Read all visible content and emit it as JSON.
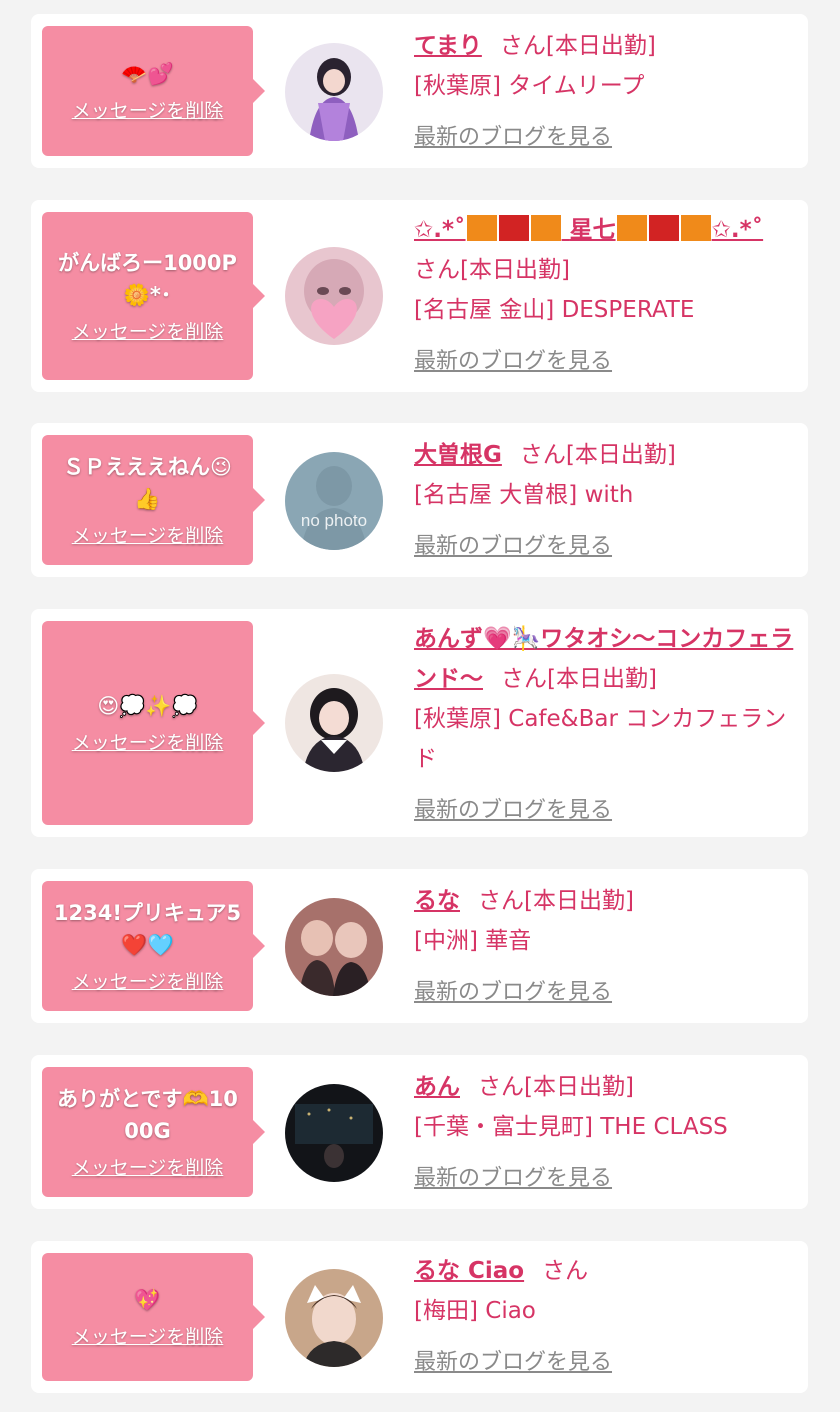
{
  "delete_label": "メッセージを削除",
  "blog_label": "最新のブログを見る",
  "san_label": "さん",
  "today_label": "[本日出勤]",
  "colors": {
    "bubble": "#f58da3",
    "accent": "#d63465",
    "link_gray": "#8a8a8a",
    "background": "#f3f3f3"
  },
  "entries": [
    {
      "message": "🪭💕",
      "name": "てまり",
      "today": "[本日出勤]",
      "shop": "[秋葉原] タイムリープ",
      "avatar_icon": "avatar-photo"
    },
    {
      "message": "がんばろー1000P🌼*･",
      "name_prefix": "✩.*˚",
      "name_core": "星七",
      "name_suffix": "✩.*˚",
      "name_blocks": [
        "🟧",
        "🟥",
        "🟧"
      ],
      "today": "[本日出勤]",
      "shop": "[名古屋 金山] DESPERATE",
      "avatar_icon": "avatar-photo"
    },
    {
      "message": "ＳＰえええねん😉👍",
      "name": "大曽根G",
      "today": "[本日出勤]",
      "shop": "[名古屋 大曽根] with",
      "avatar_icon": "no-photo-avatar",
      "avatar_text": "no photo"
    },
    {
      "message": "😍💭✨💭",
      "name": "あんず💗🎠ワタオシ〜コンカフェランド〜",
      "today": "[本日出勤]",
      "shop": "[秋葉原] Cafe&Bar コンカフェランド",
      "avatar_icon": "avatar-photo"
    },
    {
      "message": "1234!プリキュア5❤️🩵",
      "name": "るな",
      "today": "[本日出勤]",
      "shop": "[中洲] 華音",
      "avatar_icon": "avatar-photo"
    },
    {
      "message": "ありがとです🫶1000G",
      "name": "あん",
      "today": "[本日出勤]",
      "shop": "[千葉・富士見町] THE CLASS",
      "avatar_icon": "avatar-photo"
    },
    {
      "message": "💖",
      "name": "るな Ciao",
      "today": "",
      "shop": "[梅田] Ciao",
      "avatar_icon": "avatar-photo"
    }
  ]
}
